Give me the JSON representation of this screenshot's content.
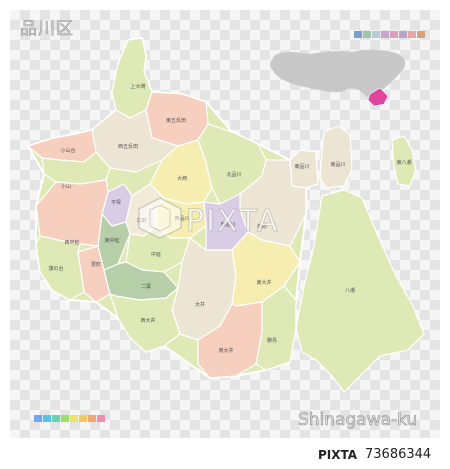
{
  "map": {
    "title": "品川区",
    "romaji": "Shinagawa-ku",
    "watermark_text": "PIXTA",
    "footer": {
      "brand": "PIXTA",
      "stock_id": "73686344"
    },
    "colors": {
      "green": "#dfe9b6",
      "beige": "#ece5d3",
      "pink": "#f6cfbe",
      "yellow": "#f5eeb0",
      "purple": "#d9cde6",
      "midgreen": "#c9dcb2",
      "darkgreen": "#b6cfa8",
      "cream": "#f2ead8",
      "border": "#ffffff",
      "inset_gray": "#c8c8c8",
      "inset_highlight": "#e0449c"
    },
    "swatch_colors_top": [
      "#7b9fd1",
      "#9fc6a8",
      "#b9c9d6",
      "#c6a8cf",
      "#d9a0b9",
      "#b5a6c7",
      "#e8a6a6",
      "#d3a37f"
    ],
    "swatch_colors_bottom": [
      "#6fa6ee",
      "#56c4e8",
      "#6bd3b3",
      "#9fdc6e",
      "#e9e36a",
      "#f6c665",
      "#f2a777",
      "#f18db5"
    ],
    "districts": [
      {
        "name": "上大崎"
      },
      {
        "name": "東五反田"
      },
      {
        "name": "西五反田"
      },
      {
        "name": "小山台"
      },
      {
        "name": "小山"
      },
      {
        "name": "大崎"
      },
      {
        "name": "北品川"
      },
      {
        "name": "東品川"
      },
      {
        "name": "東品川"
      },
      {
        "name": "東八潮"
      },
      {
        "name": "荏原"
      },
      {
        "name": "平塚"
      },
      {
        "name": "西品川"
      },
      {
        "name": "南品川"
      },
      {
        "name": "広町"
      },
      {
        "name": "東中延"
      },
      {
        "name": "西中延"
      },
      {
        "name": "中延"
      },
      {
        "name": "豊町"
      },
      {
        "name": "二葉"
      },
      {
        "name": "旗の台"
      },
      {
        "name": "大井"
      },
      {
        "name": "西大井"
      },
      {
        "name": "東大井"
      },
      {
        "name": "南大井"
      },
      {
        "name": "勝島"
      },
      {
        "name": "八潮"
      }
    ]
  }
}
